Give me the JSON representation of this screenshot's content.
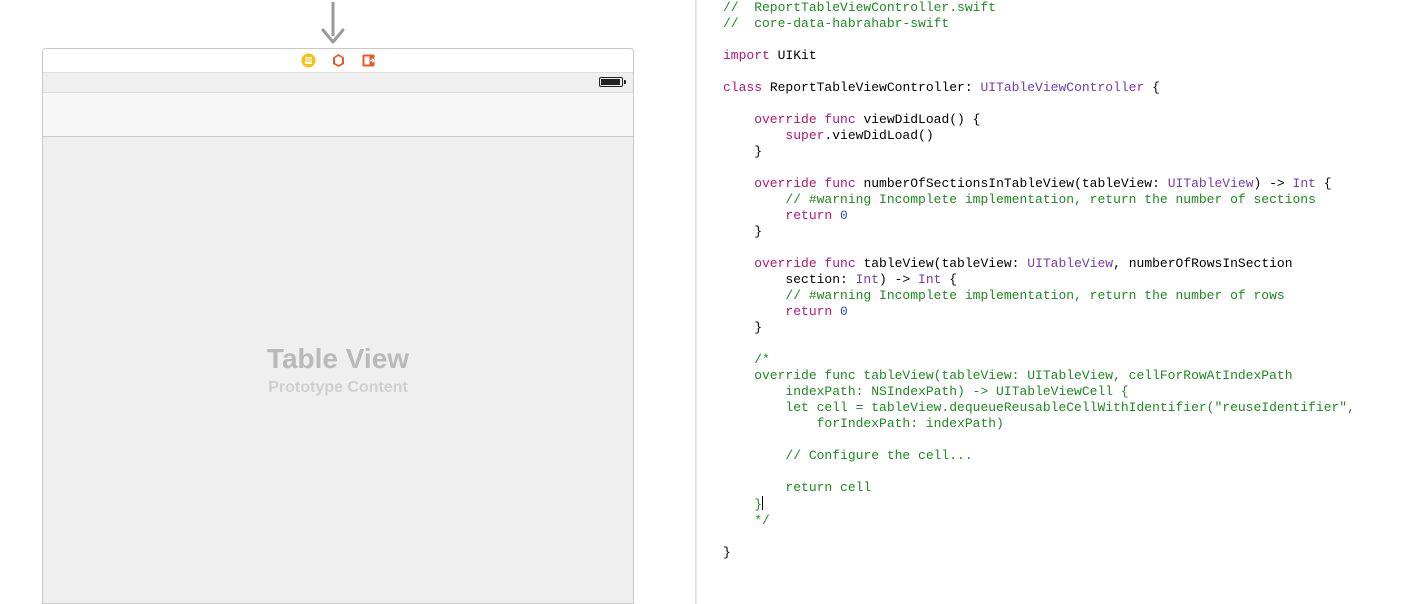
{
  "ib": {
    "tableview_title": "Table View",
    "tableview_subtitle": "Prototype Content"
  },
  "code": {
    "l1a": "//  ReportTableViewController.swift",
    "l1b": "//  core-data-habrahabr-swift",
    "import_kw": "import",
    "import_mod": " UIKit",
    "class_kw": "class",
    "class_name": " ReportTableViewController: ",
    "class_type": "UITableViewController",
    "class_brace": " {",
    "vdl_override": "    override",
    "vdl_func": " func",
    "vdl_sig": " viewDidLoad() {",
    "vdl_super_kw": "        super",
    "vdl_super_call": ".viewDidLoad()",
    "vdl_close": "    }",
    "nos_override": "    override",
    "nos_func": " func",
    "nos_sig1": " numberOfSectionsInTableView(tableView: ",
    "nos_type1": "UITableView",
    "nos_sig2": ") -> ",
    "nos_type2": "Int",
    "nos_sig3": " {",
    "nos_comment": "        // #warning Incomplete implementation, return the number of sections",
    "nos_ret_kw": "        return",
    "nos_ret_val": " 0",
    "nos_close": "    }",
    "nrow_override": "    override",
    "nrow_func": " func",
    "nrow_sig1": " tableView(tableView: ",
    "nrow_type1": "UITableView",
    "nrow_sig2": ", numberOfRowsInSection",
    "nrow_line2a": "        section: ",
    "nrow_type2": "Int",
    "nrow_line2b": ") -> ",
    "nrow_type3": "Int",
    "nrow_line2c": " {",
    "nrow_comment": "        // #warning Incomplete implementation, return the number of rows",
    "nrow_ret_kw": "        return",
    "nrow_ret_val": " 0",
    "nrow_close": "    }",
    "blk_open": "    /*",
    "blk_l1": "    override func tableView(tableView: UITableView, cellForRowAtIndexPath",
    "blk_l2": "        indexPath: NSIndexPath) -> UITableViewCell {",
    "blk_l3": "        let cell = tableView.dequeueReusableCellWithIdentifier(\"reuseIdentifier\",",
    "blk_l4": "            forIndexPath: indexPath)",
    "blk_l5": "        // Configure the cell...",
    "blk_l6": "        return cell",
    "blk_l7": "    }",
    "blk_close": "    */",
    "class_close": "}"
  }
}
